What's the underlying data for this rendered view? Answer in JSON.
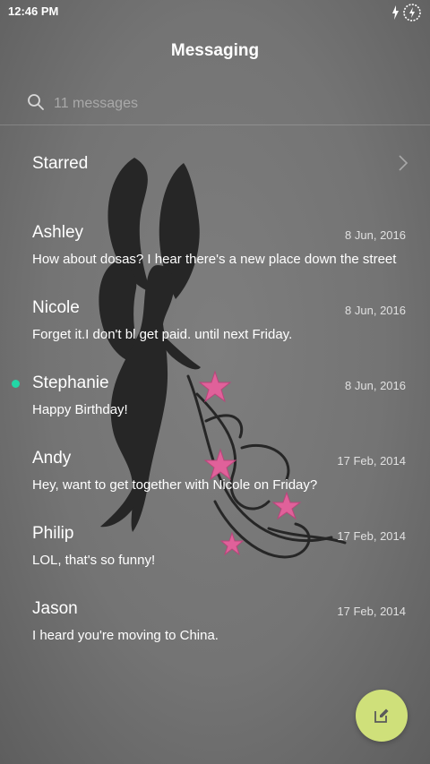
{
  "status_bar": {
    "time": "12:46 PM",
    "icons": [
      "charging-bolt-icon",
      "battery-ring-icon"
    ]
  },
  "header": {
    "title": "Messaging"
  },
  "search": {
    "placeholder": "11 messages",
    "icon": "search-icon"
  },
  "starred": {
    "label": "Starred",
    "icon": "chevron-right-icon"
  },
  "conversations": [
    {
      "name": "Ashley",
      "date": "8 Jun, 2016",
      "snippet": "How about dosas? I hear there's a new place down the street",
      "unread": false
    },
    {
      "name": "Nicole",
      "date": "8 Jun, 2016",
      "snippet": "Forget it.I don't bl get paid. until next Friday.",
      "unread": false
    },
    {
      "name": "Stephanie",
      "date": "8 Jun, 2016",
      "snippet": "Happy Birthday!",
      "unread": true
    },
    {
      "name": "Andy",
      "date": "17 Feb, 2014",
      "snippet": "Hey, want to get together with Nicole on Friday?",
      "unread": false
    },
    {
      "name": "Philip",
      "date": "17 Feb, 2014",
      "snippet": "LOL, that's so funny!",
      "unread": false
    },
    {
      "name": "Jason",
      "date": "17 Feb, 2014",
      "snippet": "I heard you're moving to China.",
      "unread": false
    }
  ],
  "compose": {
    "icon": "compose-icon"
  },
  "colors": {
    "unread_dot": "#22d7a6",
    "compose_button": "#cfe07a",
    "flower": "#e0619a",
    "silhouette": "#262626"
  }
}
